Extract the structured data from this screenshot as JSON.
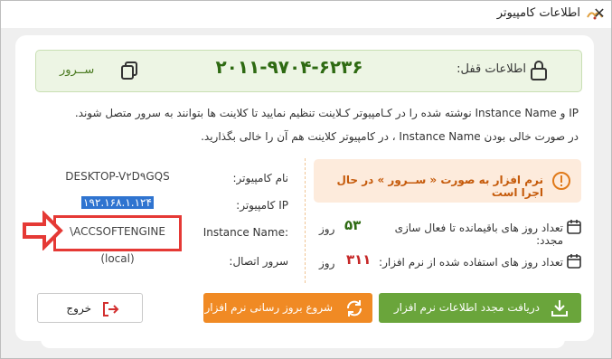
{
  "window": {
    "title": "اطلاعات کامپیوتر",
    "close_glyph": "✕"
  },
  "lock": {
    "label": "اطلاعات قفل:",
    "code": "۲۰۱۱-۹۷۰۴-۶۲۳۶",
    "server_label": "ســرور"
  },
  "description": {
    "line1": "IP و Instance Name نوشته شده را در کـامپیوتر کـلاینت تنظیم نمایید تا کلاینت ها بتوانند به سرور متصل شوند.",
    "line2": "در صورت خالی بودن Instance Name ، در کامپیوتر کلاینت هم آن را خالی بگذارید."
  },
  "computer": {
    "name_label": "نام کامپیوتر:",
    "name_value": "DESKTOP-V۲D۹GQS",
    "ip_label": "IP کامپیوتر:",
    "ip_value": "۱۹۲.۱۶۸.۱.۱۲۴",
    "instance_label": "Instance Name:",
    "instance_value": "\\ACCSOFTENGINE",
    "conn_label": "سرور اتصال:",
    "conn_value": "(local)"
  },
  "status": {
    "warn_text": "نرم افزار به صورت « ســرور » در حال اجرا است",
    "remaining_label": "تعداد روز های باقیمانده تا فعال سازی مجدد:",
    "remaining_value": "۵۳",
    "used_label": "تعداد روز های استفاده شده از نرم افزار:",
    "used_value": "۳۱۱",
    "day_unit": "روز"
  },
  "buttons": {
    "refresh": "دریافت مجدد اطلاعات نرم افزار",
    "update": "شروع بروز رسانی نرم افزار",
    "exit": "خروج"
  },
  "colors": {
    "green": "#6aa53b",
    "orange": "#f08a24",
    "code_green": "#2e6a12",
    "red_num": "#c62828",
    "highlight": "#2f74d0",
    "annotation_red": "#e53935"
  },
  "icons": {
    "lock": "lock-icon",
    "server": "copy-icon",
    "warning": "info-icon",
    "calendar": "calendar-icon",
    "download": "download-icon",
    "sync": "sync-icon",
    "exit": "exit-icon"
  }
}
